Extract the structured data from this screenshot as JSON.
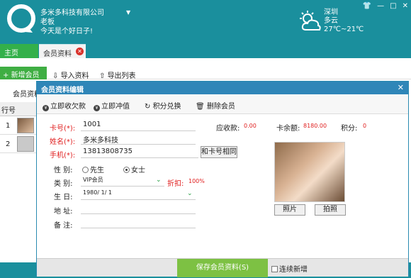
{
  "header": {
    "company": "多米多科技有限公司",
    "user": "老板",
    "greeting": "今天是个好日子!",
    "weather": {
      "city": "深圳",
      "condition": "多云",
      "temp": "27℃~21℃"
    }
  },
  "tabs": {
    "home": "主页",
    "member": "会员资料"
  },
  "toolbar": {
    "new_member": "新增会员",
    "import": "导入资料",
    "export": "导出列表"
  },
  "left": {
    "section_label": "会员资料",
    "column_row": "行号",
    "rows": [
      {
        "num": "1"
      },
      {
        "num": "2"
      }
    ]
  },
  "dialog": {
    "title": "会员资料编辑",
    "actions": [
      "立即收欠款",
      "立即冲值",
      "积分兑换",
      "删除会员"
    ],
    "form": {
      "card_label": "卡号(*):",
      "card_value": "1001",
      "name_label": "姓名(*):",
      "name_value": "多米多科技",
      "phone_label": "手机(*):",
      "phone_value": "13813808735",
      "same_as_card": "和卡号相同",
      "gender_label": "性  别:",
      "gender_male": "先生",
      "gender_female": "女士",
      "type_label": "类  别:",
      "type_value": "VIP会员",
      "discount_label": "折扣:",
      "discount_value": "100%",
      "birthday_label": "生  日:",
      "birthday_value": "1980/ 1/ 1",
      "address_label": "地  址:",
      "note_label": "备  注:"
    },
    "summary": {
      "receivable_label": "应收款:",
      "receivable_value": "0.00",
      "balance_label": "卡余额:",
      "balance_value": "8180.00",
      "points_label": "积分:",
      "points_value": "0"
    },
    "photo_btn": "照片",
    "capture_btn": "拍照",
    "save_btn": "保存会员资料(S)",
    "continue_add": "连续新增"
  }
}
